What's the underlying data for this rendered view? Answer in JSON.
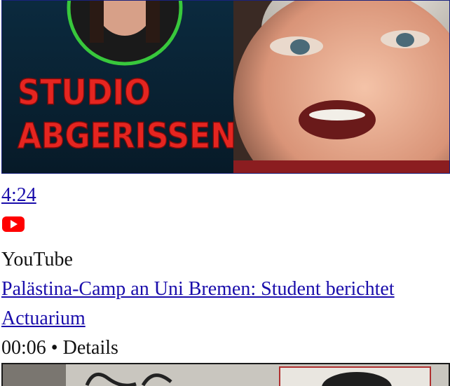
{
  "video1": {
    "thumbnail_text_line1": "STUDIO",
    "thumbnail_text_line2": "ABGERISSEN",
    "duration": "4:24"
  },
  "source": {
    "icon": "youtube-icon",
    "name": "YouTube"
  },
  "video2": {
    "title": "Palästina-Camp an Uni Bremen: Student berichtet",
    "channel": "Actuarium",
    "duration": "00:06",
    "separator": "•",
    "details_label": "Details"
  },
  "colors": {
    "link": "#1a0dab",
    "youtube_red": "#ff0000",
    "thumbnail_text_red": "#e52520",
    "thumbnail_circle_green": "#38c83c"
  }
}
